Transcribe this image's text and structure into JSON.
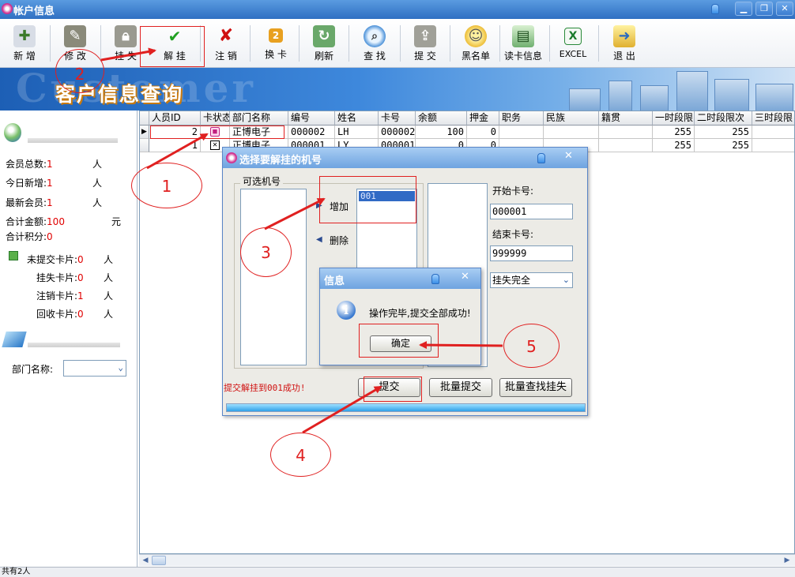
{
  "window": {
    "title": "帐户信息"
  },
  "toolbar": {
    "items": [
      {
        "label": "新 增"
      },
      {
        "label": "修 改"
      },
      {
        "label": "挂 失"
      },
      {
        "label": "解 挂"
      },
      {
        "label": "注 销"
      },
      {
        "label": "换 卡"
      },
      {
        "label": "刷新"
      },
      {
        "label": "查 找"
      },
      {
        "label": "提 交"
      },
      {
        "label": "黑名单"
      },
      {
        "label": "读卡信息"
      },
      {
        "label": "EXCEL"
      },
      {
        "label": "退 出"
      }
    ]
  },
  "banner": {
    "bg_text": "Customer",
    "title": "客户信息查询"
  },
  "left_panel": {
    "total_members": {
      "label": "会员总数:",
      "value": "1",
      "unit": "人"
    },
    "today_new": {
      "label": "今日新增:",
      "value": "1",
      "unit": "人"
    },
    "latest_member": {
      "label": "最新会员:",
      "value": "1",
      "unit": "人"
    },
    "total_amount": {
      "label": "合计金额:",
      "value": "100",
      "unit": "元"
    },
    "total_points": {
      "label": "合计积分:",
      "value": "0"
    },
    "unsubmitted": {
      "label": "未提交卡片:",
      "value": "0",
      "unit": "人"
    },
    "lost": {
      "label": "挂失卡片:",
      "value": "0",
      "unit": "人"
    },
    "cancelled": {
      "label": "注销卡片:",
      "value": "1",
      "unit": "人"
    },
    "recycled": {
      "label": "回收卡片:",
      "value": "0",
      "unit": "人"
    },
    "dept_label": "部门名称:"
  },
  "grid": {
    "columns": [
      "人员ID",
      "卡状态",
      "部门名称",
      "编号",
      "姓名",
      "卡号",
      "余额",
      "押金",
      "职务",
      "民族",
      "籍贯",
      "一时段限",
      "二时段限次",
      "三时段限"
    ],
    "rows": [
      {
        "id": "2",
        "status": "lock",
        "dept": "正博电子",
        "code": "000002",
        "name": "LH",
        "card": "000002",
        "balance": "100",
        "deposit": "0",
        "t1": "255",
        "t2": "255"
      },
      {
        "id": "1",
        "status": "cross",
        "dept": "正博电子",
        "code": "000001",
        "name": "LY",
        "card": "000001",
        "balance": "0",
        "deposit": "0",
        "t1": "255",
        "t2": "255"
      }
    ]
  },
  "status_bar": {
    "text": "共有2人"
  },
  "dialog": {
    "title": "选择要解挂的机号",
    "group_label": "可选机号",
    "add_button": "增加",
    "delete_button": "删除",
    "selected_item": "001",
    "start_card_label": "开始卡号:",
    "start_card_value": "000001",
    "end_card_label": "结束卡号:",
    "end_card_value": "999999",
    "mode_value": "挂失完全",
    "result_text": "提交解挂到001成功!",
    "submit_button": "提交",
    "batch_submit_button": "批量提交",
    "batch_find_button": "批量查找挂失",
    "progress": 1.0
  },
  "msgbox": {
    "title": "信息",
    "message": "操作完毕,提交全部成功!",
    "ok_button": "确定"
  },
  "annotations": [
    "1",
    "2",
    "3",
    "4",
    "5"
  ],
  "colors": {
    "accent_red": "#e02020",
    "title_blue": "#2f6fc2",
    "value_red": "#e00000"
  }
}
